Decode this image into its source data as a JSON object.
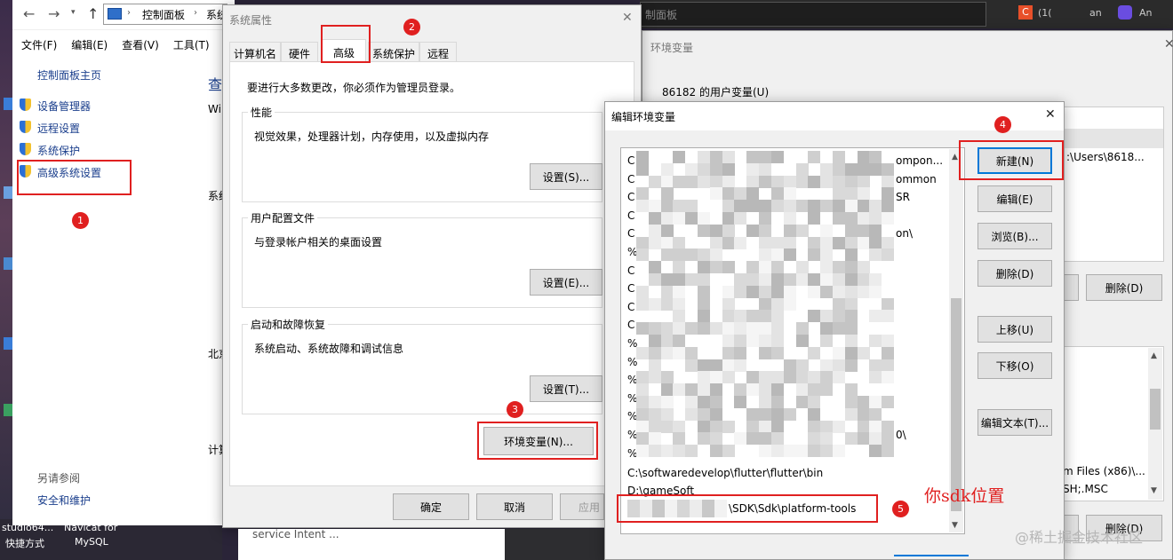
{
  "explorer": {
    "breadcrumb": [
      "控制面板",
      "系统"
    ],
    "menu": [
      "文件(F)",
      "编辑(E)",
      "查看(V)",
      "工具(T)"
    ],
    "home_link": "控制面板主页",
    "nav_items": [
      "设备管理器",
      "远程设置",
      "系统保护",
      "高级系统设置"
    ],
    "see_also_title": "另请参阅",
    "see_also_item": "安全和维护",
    "partial_texts": [
      "查",
      "Wi",
      "系统",
      "北京",
      "计算"
    ]
  },
  "desktop": {
    "labels": [
      "studio64...",
      "Navicat for",
      "快捷方式",
      "MySQL",
      "service Intent ..."
    ]
  },
  "browser_bar": {
    "address_text": "制面板",
    "tabs": [
      "C",
      "(1(",
      "an",
      "An"
    ]
  },
  "sys_props": {
    "title": "系统属性",
    "tabs": [
      "计算机名",
      "硬件",
      "高级",
      "系统保护",
      "远程"
    ],
    "active_tab": "高级",
    "admin_note": "要进行大多数更改，你必须作为管理员登录。",
    "groups": [
      {
        "title": "性能",
        "desc": "视觉效果，处理器计划，内存使用，以及虚拟内存",
        "button": "设置(S)..."
      },
      {
        "title": "用户配置文件",
        "desc": "与登录帐户相关的桌面设置",
        "button": "设置(E)..."
      },
      {
        "title": "启动和故障恢复",
        "desc": "系统启动、系统故障和调试信息",
        "button": "设置(T)..."
      }
    ],
    "env_button": "环境变量(N)...",
    "ok": "确定",
    "cancel": "取消",
    "apply": "应用"
  },
  "env_vars": {
    "title": "环境变量",
    "user_section": "86182 的用户变量(U)",
    "partial_value": ":\\Users\\8618...",
    "delete_button": "删除(D)",
    "delete_button2": "删除(D)",
    "sys_values": [
      "m Files (x86)\\...",
      "SH;.MSC"
    ]
  },
  "edit_env": {
    "title": "编辑环境变量",
    "list_items": [
      {
        "prefix": "C",
        "suffix": "ompon..."
      },
      {
        "prefix": "C",
        "suffix": "ommon"
      },
      {
        "prefix": "C",
        "suffix": "SR"
      },
      {
        "prefix": "C",
        "suffix": ""
      },
      {
        "prefix": "C",
        "suffix": "on\\"
      },
      {
        "prefix": "%",
        "suffix": ""
      },
      {
        "prefix": "C",
        "suffix": ""
      },
      {
        "prefix": "C",
        "suffix": ""
      },
      {
        "prefix": "C",
        "suffix": ""
      },
      {
        "prefix": "C",
        "suffix": ""
      },
      {
        "prefix": "%",
        "suffix": ""
      },
      {
        "prefix": "%",
        "suffix": ""
      },
      {
        "prefix": "%",
        "suffix": ""
      },
      {
        "prefix": "%",
        "suffix": ""
      },
      {
        "prefix": "%",
        "suffix": ""
      },
      {
        "prefix": "%",
        "suffix": "0\\"
      },
      {
        "prefix": "%",
        "suffix": ""
      }
    ],
    "flutter_path": "C:\\softwaredevelop\\flutter\\flutter\\bin",
    "gamesoft_path": "D:\\gameSoft",
    "sdk_path": "\\SDK\\Sdk\\platform-tools",
    "buttons": [
      "新建(N)",
      "编辑(E)",
      "浏览(B)...",
      "删除(D)",
      "上移(U)",
      "下移(O)",
      "编辑文本(T)..."
    ]
  },
  "annotations": {
    "badges": [
      "1",
      "2",
      "3",
      "4",
      "5"
    ],
    "sdk_note": "你sdk位置",
    "watermark": "@稀土掘金技术社区"
  },
  "colors": {
    "highlight_red": "#e02020",
    "selection_blue": "#0078d7",
    "link_blue": "#1a3e8c"
  }
}
